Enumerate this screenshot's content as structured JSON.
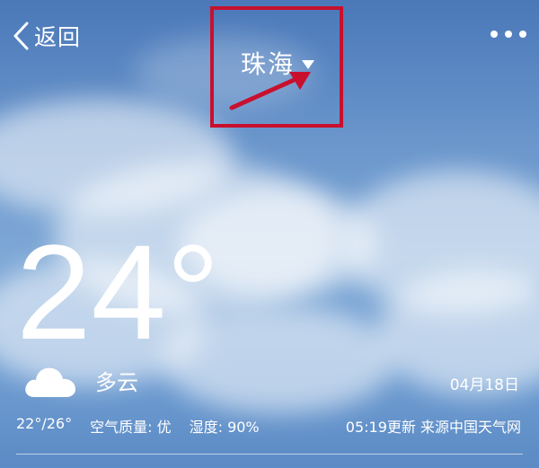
{
  "header": {
    "back_label": "返回",
    "city": "珠海"
  },
  "current": {
    "temperature": "24°",
    "condition": "多云",
    "date": "04月18日"
  },
  "details": {
    "range": "22°/26°",
    "air_quality": "空气质量: 优",
    "humidity": "湿度: 90%",
    "updated_source": "05:19更新 来源中国天气网"
  },
  "icons": {
    "back": "chevron-left-icon",
    "more": "more-dots-icon",
    "dropdown": "triangle-down-icon",
    "weather": "cloud-icon"
  },
  "colors": {
    "highlight": "#c8102e",
    "text": "#ffffff"
  }
}
